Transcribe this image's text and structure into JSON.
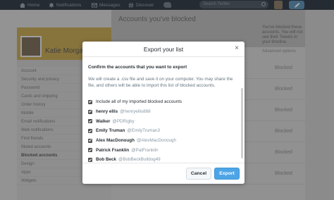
{
  "colors": {
    "accent": "#4ea5e6",
    "topbar": "#2b3440",
    "profile_banner": "#c9a84f"
  },
  "topbar": {
    "items": [
      {
        "label": "Home",
        "icon": "home-icon"
      },
      {
        "label": "Notifications",
        "icon": "bell-icon"
      },
      {
        "label": "Messages",
        "icon": "envelope-icon"
      },
      {
        "label": "Discover",
        "icon": "hashtag-icon"
      }
    ],
    "search_placeholder": "Search Twitter"
  },
  "profile": {
    "name": "Katie Morgan"
  },
  "sidebar": {
    "items": [
      {
        "label": "Account"
      },
      {
        "label": "Security and privacy"
      },
      {
        "label": "Password"
      },
      {
        "label": "Cards and shipping"
      },
      {
        "label": "Order history"
      },
      {
        "label": "Mobile"
      },
      {
        "label": "Email notifications"
      },
      {
        "label": "Web notifications"
      },
      {
        "label": "Find friends"
      },
      {
        "label": "Muted accounts"
      },
      {
        "label": "Blocked accounts"
      },
      {
        "label": "Design"
      },
      {
        "label": "Apps"
      },
      {
        "label": "Widgets"
      }
    ]
  },
  "main": {
    "title": "Accounts you've blocked",
    "description": "You've blocked these accounts. You will not see their Tweets in your timeline.",
    "advanced_options": "Advanced options",
    "blocked_label": "Blocked"
  },
  "modal": {
    "title": "Export your list",
    "close_label": "×",
    "heading": "Confirm the accounts that you want to export",
    "description": "We will create a .csv file and save it on your computer. You may share the file, and others will be able to import this list of blocked accounts.",
    "include_label": "Include all of my imported blocked accounts",
    "accounts": [
      {
        "name": "henry ellis",
        "handle": "@henryellis888"
      },
      {
        "name": "Walker",
        "handle": "@PDRigby"
      },
      {
        "name": "Emily Truman",
        "handle": "@EmilyTruman3"
      },
      {
        "name": "Alex MacDonough",
        "handle": "@AlexMacDonough"
      },
      {
        "name": "Patrick Franklin",
        "handle": "@PatFranklin"
      },
      {
        "name": "Bob Beck",
        "handle": "@BobBeckBulldog49"
      }
    ],
    "cancel_label": "Cancel",
    "export_label": "Export"
  }
}
